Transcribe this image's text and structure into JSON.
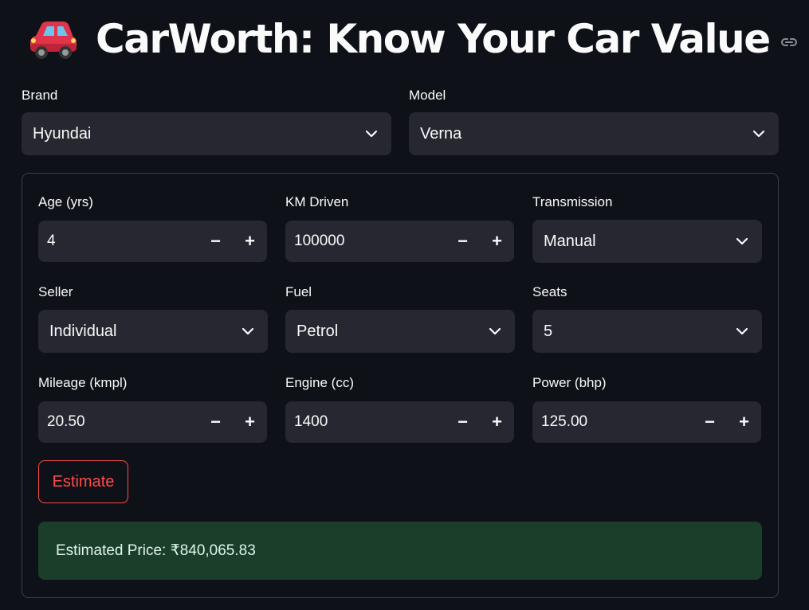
{
  "header": {
    "title": "CarWorth: Know Your Car Value",
    "car_emoji": "red-car-icon",
    "link_icon": "link-icon"
  },
  "brand": {
    "label": "Brand",
    "value": "Hyundai"
  },
  "model": {
    "label": "Model",
    "value": "Verna"
  },
  "form": {
    "age": {
      "label": "Age (yrs)",
      "value": "4"
    },
    "km": {
      "label": "KM Driven",
      "value": "100000"
    },
    "transmission": {
      "label": "Transmission",
      "value": "Manual"
    },
    "seller": {
      "label": "Seller",
      "value": "Individual"
    },
    "fuel": {
      "label": "Fuel",
      "value": "Petrol"
    },
    "seats": {
      "label": "Seats",
      "value": "5"
    },
    "mileage": {
      "label": "Mileage (kmpl)",
      "value": "20.50"
    },
    "engine": {
      "label": "Engine (cc)",
      "value": "1400"
    },
    "power": {
      "label": "Power (bhp)",
      "value": "125.00"
    }
  },
  "stepper": {
    "minus": "−",
    "plus": "+"
  },
  "actions": {
    "estimate_label": "Estimate"
  },
  "result": {
    "text": "Estimated Price: ₹840,065.83"
  },
  "colors": {
    "background": "#0e1117",
    "input": "#262730",
    "accent": "#ff4b4b",
    "success_bg": "#1b3e2b"
  }
}
